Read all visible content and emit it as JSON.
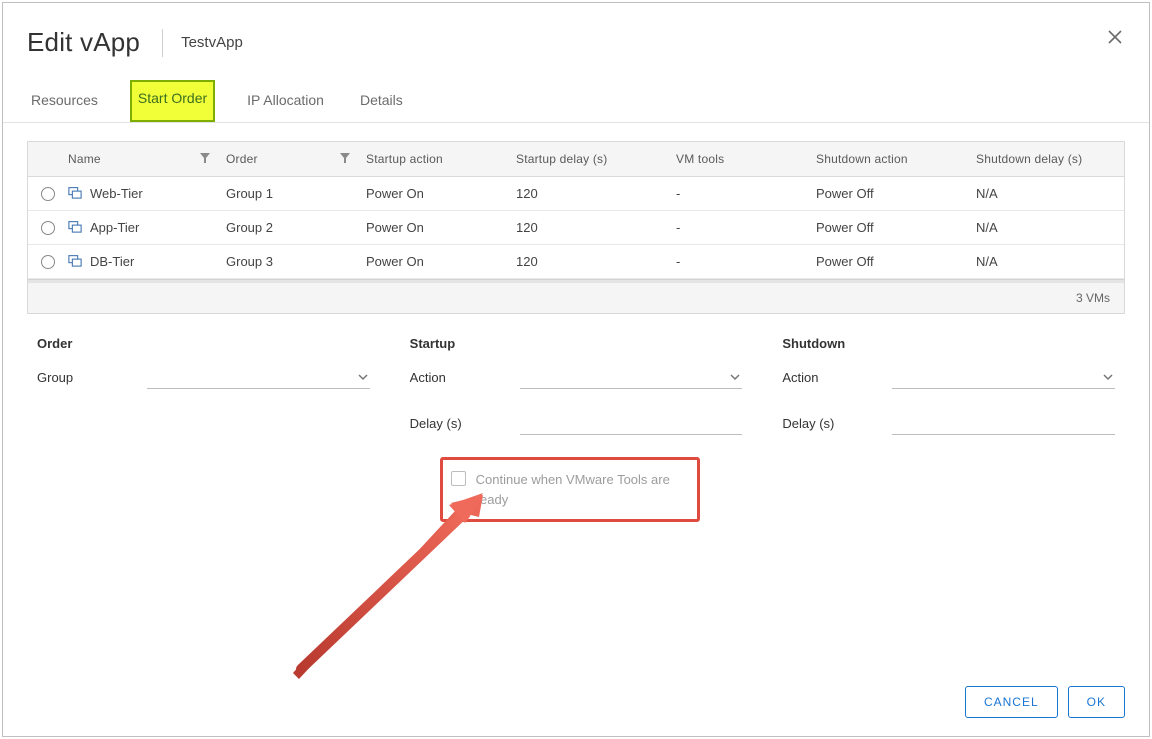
{
  "header": {
    "title": "Edit vApp",
    "subtitle": "TestvApp"
  },
  "tabs": [
    {
      "label": "Resources",
      "active": false
    },
    {
      "label": "Start Order",
      "active": true
    },
    {
      "label": "IP Allocation",
      "active": false
    },
    {
      "label": "Details",
      "active": false
    }
  ],
  "table": {
    "columns": {
      "name": "Name",
      "order": "Order",
      "startup_action": "Startup action",
      "startup_delay": "Startup delay (s)",
      "vm_tools": "VM tools",
      "shutdown_action": "Shutdown action",
      "shutdown_delay": "Shutdown delay (s)"
    },
    "rows": [
      {
        "name": "Web-Tier",
        "order": "Group 1",
        "startup_action": "Power On",
        "startup_delay": "120",
        "vm_tools": "-",
        "shutdown_action": "Power Off",
        "shutdown_delay": "N/A"
      },
      {
        "name": "App-Tier",
        "order": "Group 2",
        "startup_action": "Power On",
        "startup_delay": "120",
        "vm_tools": "-",
        "shutdown_action": "Power Off",
        "shutdown_delay": "N/A"
      },
      {
        "name": "DB-Tier",
        "order": "Group 3",
        "startup_action": "Power On",
        "startup_delay": "120",
        "vm_tools": "-",
        "shutdown_action": "Power Off",
        "shutdown_delay": "N/A"
      }
    ],
    "footer": "3 VMs"
  },
  "form": {
    "order": {
      "heading": "Order",
      "group_label": "Group"
    },
    "startup": {
      "heading": "Startup",
      "action_label": "Action",
      "delay_label": "Delay (s)",
      "vmtools_checkbox": "Continue when VMware Tools are ready"
    },
    "shutdown": {
      "heading": "Shutdown",
      "action_label": "Action",
      "delay_label": "Delay (s)"
    }
  },
  "buttons": {
    "cancel": "CANCEL",
    "ok": "OK"
  }
}
